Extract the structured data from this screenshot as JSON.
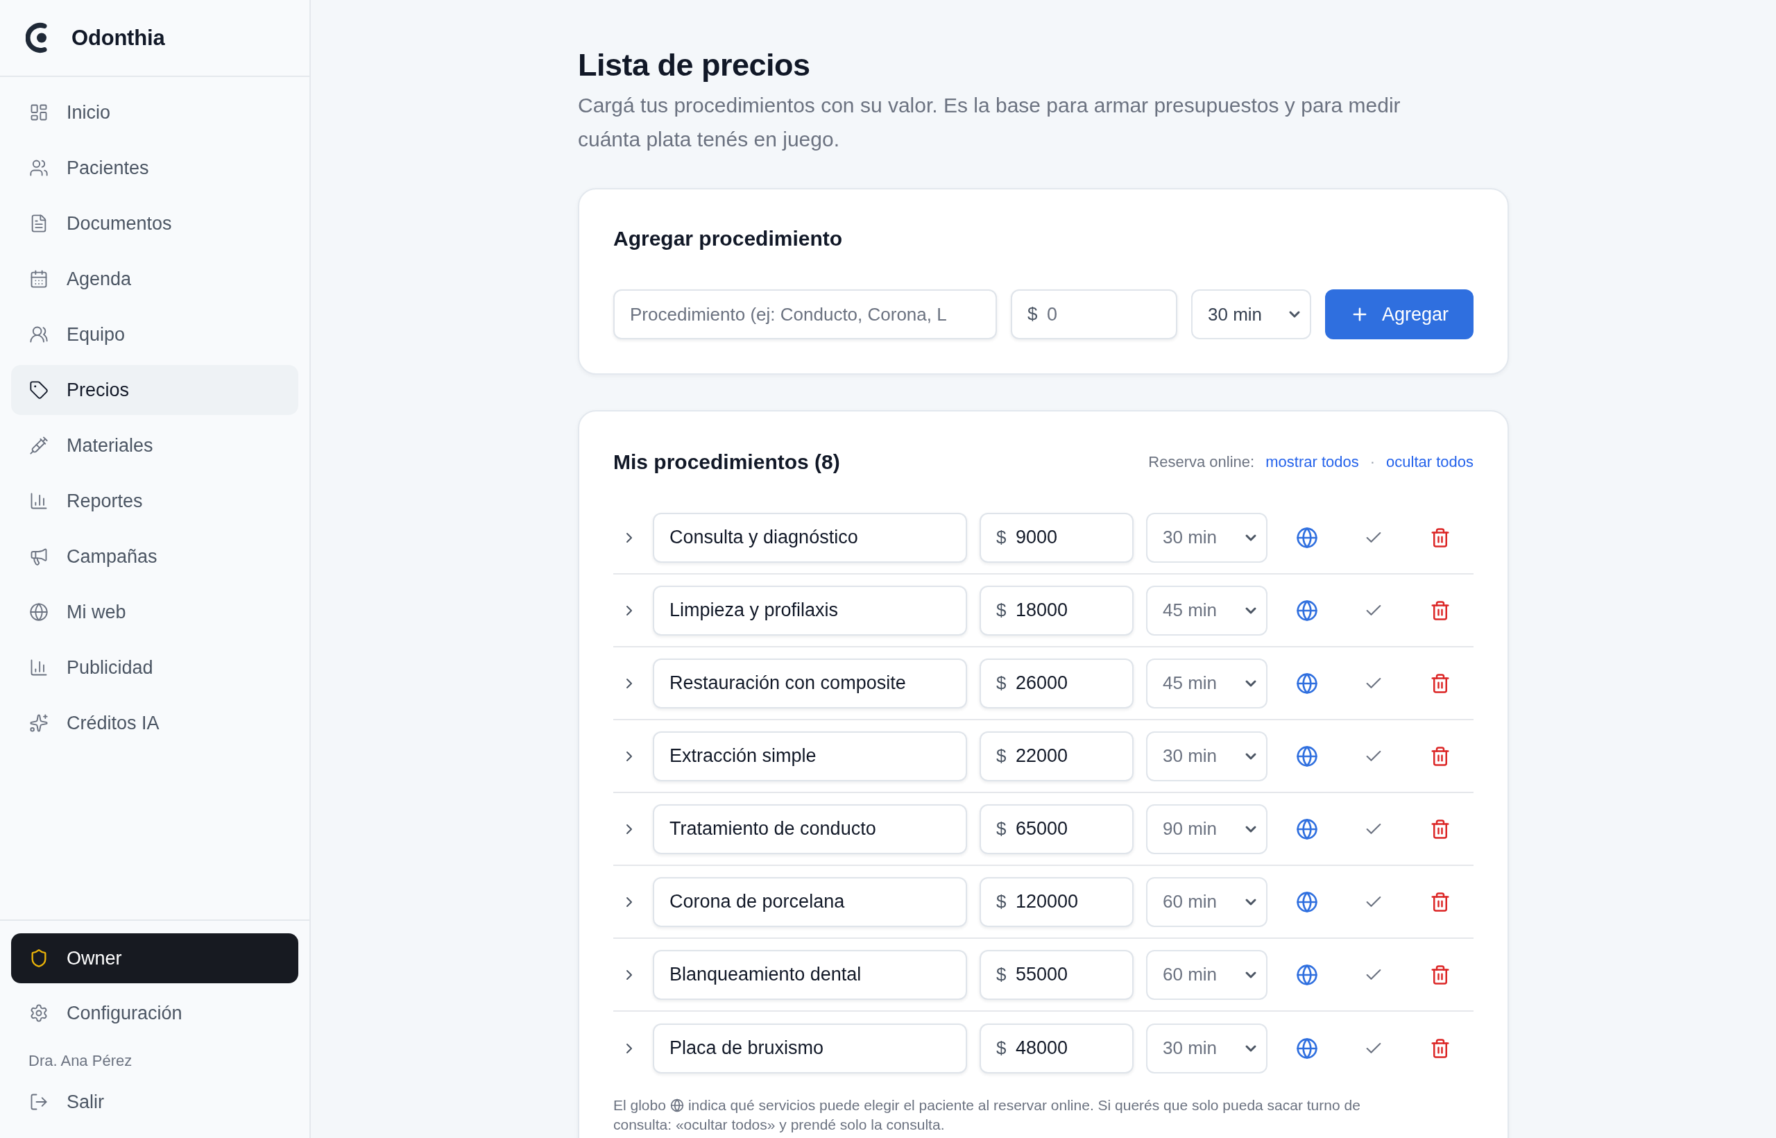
{
  "sidebar": {
    "brand": "Odonthia",
    "items": [
      {
        "label": "Inicio",
        "selected": false
      },
      {
        "label": "Pacientes",
        "selected": false
      },
      {
        "label": "Documentos",
        "selected": false
      },
      {
        "label": "Agenda",
        "selected": false
      },
      {
        "label": "Equipo",
        "selected": false
      },
      {
        "label": "Precios",
        "selected": true
      },
      {
        "label": "Materiales",
        "selected": false
      },
      {
        "label": "Reportes",
        "selected": false
      },
      {
        "label": "Campañas",
        "selected": false
      },
      {
        "label": "Mi web",
        "selected": false
      },
      {
        "label": "Publicidad",
        "selected": false
      },
      {
        "label": "Créditos IA",
        "selected": false
      }
    ],
    "role": "Owner",
    "settings": {
      "label": "Configuración",
      "selected": false
    },
    "user_name": "Dra. Ana Pérez",
    "logout": "Salir"
  },
  "header": {
    "title": "Lista de precios",
    "subtitle": "Cargá tus procedimientos con su valor. Es la base para armar presupuestos y para medir cuánta plata tenés en juego."
  },
  "add_form": {
    "title": "Agregar procedimiento",
    "name_field": {
      "placeholder": "Procedimiento (ej: Conducto, Corona, L"
    },
    "price_field": {
      "currency": "$",
      "placeholder": "0"
    },
    "duration_select": {
      "value": "30 min"
    },
    "submit_button": "Agregar"
  },
  "procedures": {
    "title": "Mis procedimientos (8)",
    "online_booking": {
      "label": "Reserva online:",
      "show_all": "mostrar todos",
      "separator": "·",
      "hide_all": "ocultar todos"
    },
    "rows": [
      {
        "name": "Consulta y diagnóstico",
        "currency": "$",
        "price": "9000",
        "duration": "30 min",
        "online": true,
        "expanded": false
      },
      {
        "name": "Limpieza y profilaxis",
        "currency": "$",
        "price": "18000",
        "duration": "45 min",
        "online": true,
        "expanded": false
      },
      {
        "name": "Restauración con composite",
        "currency": "$",
        "price": "26000",
        "duration": "45 min",
        "online": true,
        "expanded": false
      },
      {
        "name": "Extracción simple",
        "currency": "$",
        "price": "22000",
        "duration": "30 min",
        "online": true,
        "expanded": false
      },
      {
        "name": "Tratamiento de conducto",
        "currency": "$",
        "price": "65000",
        "duration": "90 min",
        "online": true,
        "expanded": false
      },
      {
        "name": "Corona de porcelana",
        "currency": "$",
        "price": "120000",
        "duration": "60 min",
        "online": true,
        "expanded": false
      },
      {
        "name": "Blanqueamiento dental",
        "currency": "$",
        "price": "55000",
        "duration": "60 min",
        "online": true,
        "expanded": false
      },
      {
        "name": "Placa de bruxismo",
        "currency": "$",
        "price": "48000",
        "duration": "30 min",
        "online": true,
        "expanded": false
      }
    ],
    "footnote": {
      "before_icon": "El globo",
      "after_icon": "indica qué servicios puede elegir el paciente al reservar online. Si querés que solo pueda sacar turno de",
      "second_line": "consulta: «ocultar todos» y prendé solo la consulta."
    }
  }
}
